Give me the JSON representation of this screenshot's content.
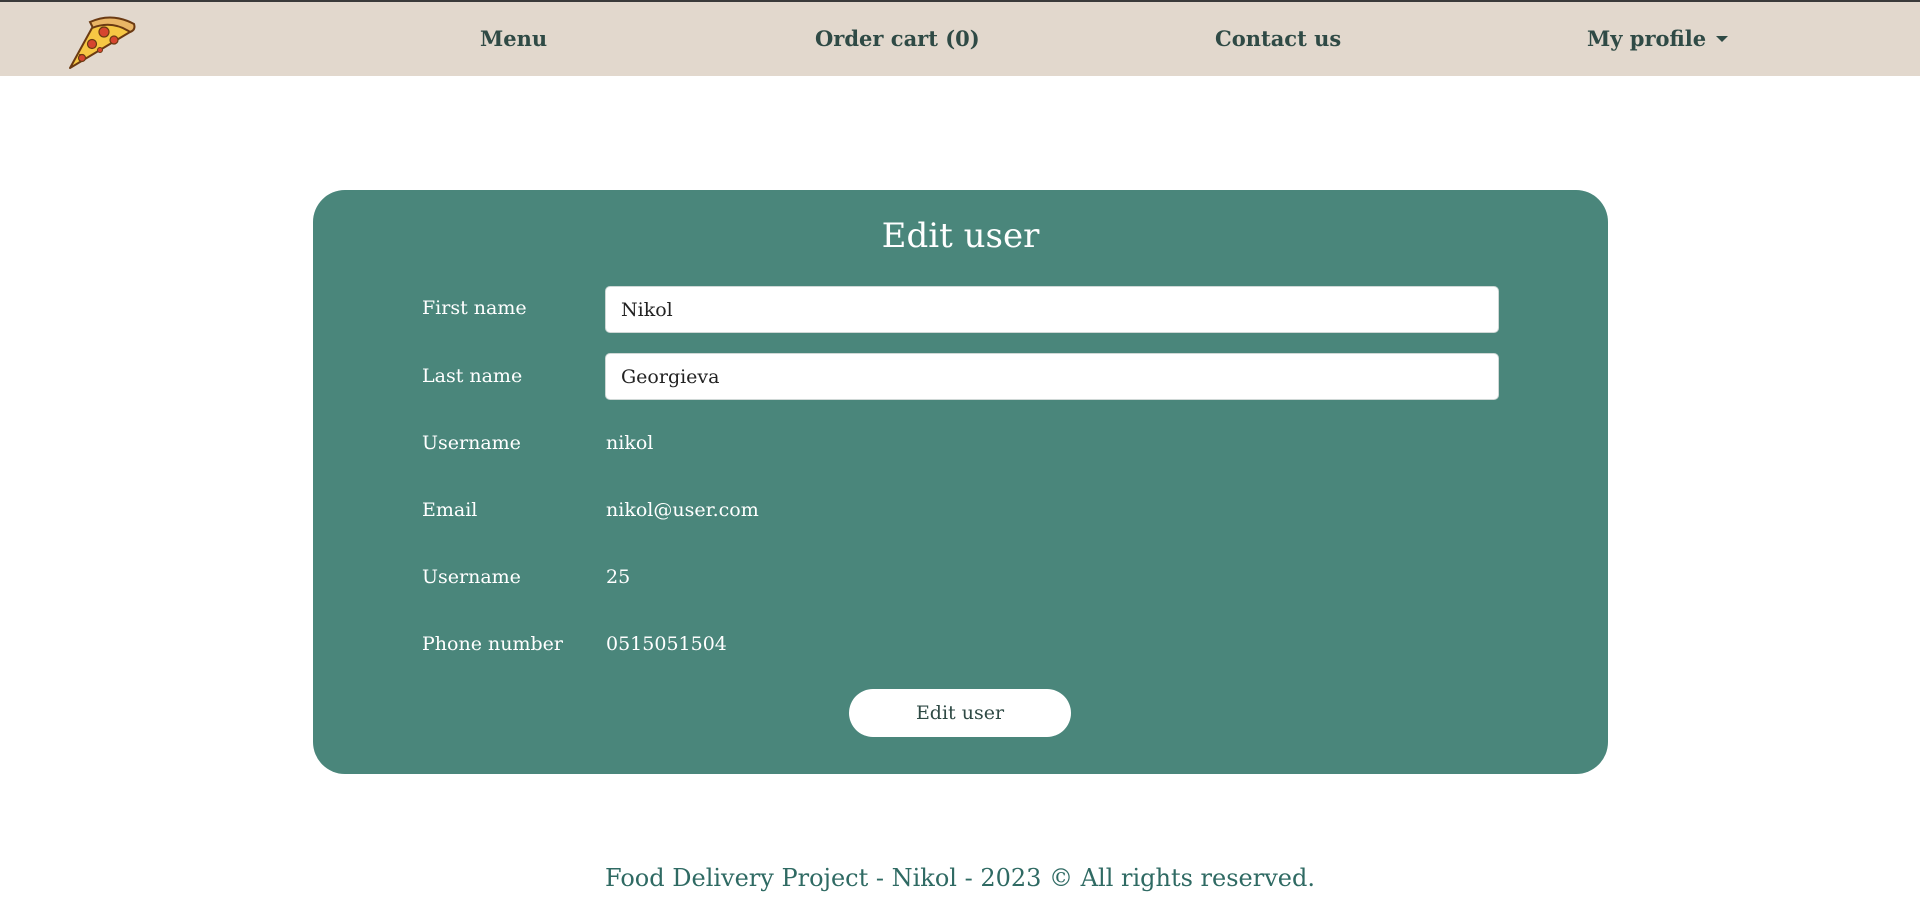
{
  "nav": {
    "logo_icon": "pizza-slice-icon",
    "menu_label": "Menu",
    "cart_label": "Order cart (0)",
    "contact_label": "Contact us",
    "profile_label": "My profile"
  },
  "form": {
    "title": "Edit user",
    "fields": [
      {
        "label": "First name",
        "value": "Nikol",
        "editable": true
      },
      {
        "label": "Last name",
        "value": "Georgieva",
        "editable": true
      },
      {
        "label": "Username",
        "value": "nikol",
        "editable": false
      },
      {
        "label": "Email",
        "value": "nikol@user.com",
        "editable": false
      },
      {
        "label": "Username",
        "value": "25",
        "editable": false
      },
      {
        "label": "Phone number",
        "value": "0515051504",
        "editable": false
      }
    ],
    "submit_label": "Edit user"
  },
  "footer": {
    "text": "Food Delivery Project - Nikol - 2023 © All rights reserved."
  },
  "colors": {
    "navbar_bg": "#e2d8cd",
    "card_bg": "#4a867b",
    "nav_text": "#2f4a45",
    "footer_text": "#2f6a63"
  }
}
